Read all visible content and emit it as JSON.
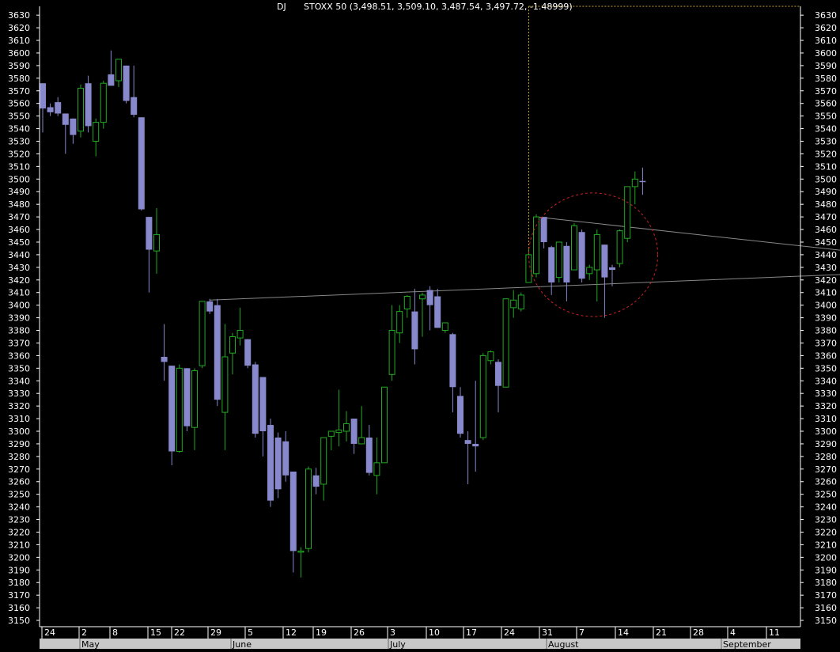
{
  "header": {
    "source": "DJ",
    "quote": "STOXX 50 (3,498.51, 3,509.10, 3,487.54, 3,497.72, -1.48999)"
  },
  "colors": {
    "background": "#000000",
    "axis": "#ffffff",
    "up": "#22aa22",
    "down": "#8888cc",
    "trendline": "#888888",
    "circle": "#cc2222",
    "crosshair": "#ccaa33",
    "bottom_bar": "#c8c8c8"
  },
  "chart_data": {
    "type": "candlestick",
    "title": "STOXX 50",
    "ylim": [
      3145,
      3637
    ],
    "y_ticks": [
      3150,
      3160,
      3170,
      3180,
      3190,
      3200,
      3210,
      3220,
      3230,
      3240,
      3250,
      3260,
      3270,
      3280,
      3290,
      3300,
      3310,
      3320,
      3330,
      3340,
      3350,
      3360,
      3370,
      3380,
      3390,
      3400,
      3410,
      3420,
      3430,
      3440,
      3450,
      3460,
      3470,
      3480,
      3490,
      3500,
      3510,
      3520,
      3530,
      3540,
      3550,
      3560,
      3570,
      3580,
      3590,
      3600,
      3610,
      3620,
      3630
    ],
    "x_day_labels": [
      "24",
      "2",
      "8",
      "15",
      "22",
      "29",
      "5",
      "12",
      "19",
      "26",
      "3",
      "10",
      "17",
      "24",
      "31",
      "7",
      "14",
      "21",
      "28",
      "4",
      "11"
    ],
    "x_month_labels": [
      "May",
      "June",
      "July",
      "August",
      "September"
    ],
    "candles": [
      {
        "o": 3576,
        "h": 3576,
        "l": 3537,
        "c": 3556
      },
      {
        "o": 3557,
        "h": 3560,
        "l": 3550,
        "c": 3553
      },
      {
        "o": 3561,
        "h": 3565,
        "l": 3550,
        "c": 3552
      },
      {
        "o": 3552,
        "h": 3552,
        "l": 3520,
        "c": 3543
      },
      {
        "o": 3548,
        "h": 3548,
        "l": 3528,
        "c": 3535
      },
      {
        "o": 3538,
        "h": 3575,
        "l": 3533,
        "c": 3572
      },
      {
        "o": 3576,
        "h": 3582,
        "l": 3537,
        "c": 3542
      },
      {
        "o": 3530,
        "h": 3548,
        "l": 3518,
        "c": 3545
      },
      {
        "o": 3545,
        "h": 3578,
        "l": 3540,
        "c": 3576
      },
      {
        "o": 3583,
        "h": 3602,
        "l": 3578,
        "c": 3574
      },
      {
        "o": 3578,
        "h": 3595,
        "l": 3573,
        "c": 3595
      },
      {
        "o": 3590,
        "h": 3590,
        "l": 3560,
        "c": 3562
      },
      {
        "o": 3565,
        "h": 3590,
        "l": 3549,
        "c": 3551
      },
      {
        "o": 3549,
        "h": 3549,
        "l": 3475,
        "c": 3476
      },
      {
        "o": 3470,
        "h": 3470,
        "l": 3410,
        "c": 3444
      },
      {
        "o": 3443,
        "h": 3477,
        "l": 3425,
        "c": 3456
      },
      {
        "o": 3359,
        "h": 3385,
        "l": 3340,
        "c": 3355
      },
      {
        "o": 3352,
        "h": 3352,
        "l": 3273,
        "c": 3284
      },
      {
        "o": 3284,
        "h": 3353,
        "l": 3283,
        "c": 3350
      },
      {
        "o": 3350,
        "h": 3350,
        "l": 3300,
        "c": 3304
      },
      {
        "o": 3303,
        "h": 3350,
        "l": 3285,
        "c": 3348
      },
      {
        "o": 3352,
        "h": 3403,
        "l": 3350,
        "c": 3403
      },
      {
        "o": 3403,
        "h": 3405,
        "l": 3393,
        "c": 3395
      },
      {
        "o": 3400,
        "h": 3405,
        "l": 3320,
        "c": 3325
      },
      {
        "o": 3315,
        "h": 3385,
        "l": 3285,
        "c": 3359
      },
      {
        "o": 3362,
        "h": 3378,
        "l": 3345,
        "c": 3375
      },
      {
        "o": 3374,
        "h": 3398,
        "l": 3368,
        "c": 3380
      },
      {
        "o": 3373,
        "h": 3373,
        "l": 3350,
        "c": 3352
      },
      {
        "o": 3353,
        "h": 3355,
        "l": 3295,
        "c": 3298
      },
      {
        "o": 3343,
        "h": 3343,
        "l": 3280,
        "c": 3300
      },
      {
        "o": 3305,
        "h": 3310,
        "l": 3240,
        "c": 3245
      },
      {
        "o": 3295,
        "h": 3299,
        "l": 3247,
        "c": 3254
      },
      {
        "o": 3292,
        "h": 3300,
        "l": 3260,
        "c": 3265
      },
      {
        "o": 3268,
        "h": 3268,
        "l": 3188,
        "c": 3205
      },
      {
        "o": 3205,
        "h": 3208,
        "l": 3184,
        "c": 3205
      },
      {
        "o": 3207,
        "h": 3272,
        "l": 3204,
        "c": 3270
      },
      {
        "o": 3265,
        "h": 3271,
        "l": 3250,
        "c": 3256
      },
      {
        "o": 3258,
        "h": 3295,
        "l": 3245,
        "c": 3295
      },
      {
        "o": 3296,
        "h": 3300,
        "l": 3285,
        "c": 3300
      },
      {
        "o": 3299,
        "h": 3333,
        "l": 3288,
        "c": 3301
      },
      {
        "o": 3300,
        "h": 3316,
        "l": 3292,
        "c": 3306
      },
      {
        "o": 3310,
        "h": 3310,
        "l": 3282,
        "c": 3290
      },
      {
        "o": 3290,
        "h": 3320,
        "l": 3290,
        "c": 3295
      },
      {
        "o": 3295,
        "h": 3305,
        "l": 3265,
        "c": 3267
      },
      {
        "o": 3265,
        "h": 3295,
        "l": 3250,
        "c": 3275
      },
      {
        "o": 3275,
        "h": 3335,
        "l": 3275,
        "c": 3335
      },
      {
        "o": 3345,
        "h": 3400,
        "l": 3340,
        "c": 3380
      },
      {
        "o": 3378,
        "h": 3400,
        "l": 3370,
        "c": 3395
      },
      {
        "o": 3397,
        "h": 3408,
        "l": 3390,
        "c": 3407
      },
      {
        "o": 3395,
        "h": 3413,
        "l": 3353,
        "c": 3365
      },
      {
        "o": 3405,
        "h": 3410,
        "l": 3375,
        "c": 3408
      },
      {
        "o": 3412,
        "h": 3415,
        "l": 3380,
        "c": 3400
      },
      {
        "o": 3407,
        "h": 3413,
        "l": 3382,
        "c": 3382
      },
      {
        "o": 3380,
        "h": 3386,
        "l": 3378,
        "c": 3386
      },
      {
        "o": 3377,
        "h": 3378,
        "l": 3315,
        "c": 3335
      },
      {
        "o": 3328,
        "h": 3335,
        "l": 3295,
        "c": 3298
      },
      {
        "o": 3293,
        "h": 3300,
        "l": 3258,
        "c": 3290
      },
      {
        "o": 3290,
        "h": 3340,
        "l": 3268,
        "c": 3288
      },
      {
        "o": 3295,
        "h": 3362,
        "l": 3293,
        "c": 3360
      },
      {
        "o": 3356,
        "h": 3364,
        "l": 3353,
        "c": 3363
      },
      {
        "o": 3355,
        "h": 3357,
        "l": 3315,
        "c": 3336
      },
      {
        "o": 3335,
        "h": 3405,
        "l": 3335,
        "c": 3405
      },
      {
        "o": 3398,
        "h": 3412,
        "l": 3390,
        "c": 3404
      },
      {
        "o": 3397,
        "h": 3410,
        "l": 3395,
        "c": 3408
      },
      {
        "o": 3418,
        "h": 3445,
        "l": 3418,
        "c": 3440
      },
      {
        "o": 3425,
        "h": 3472,
        "l": 3422,
        "c": 3470
      },
      {
        "o": 3470,
        "h": 3470,
        "l": 3445,
        "c": 3450
      },
      {
        "o": 3446,
        "h": 3447,
        "l": 3408,
        "c": 3418
      },
      {
        "o": 3422,
        "h": 3450,
        "l": 3418,
        "c": 3450
      },
      {
        "o": 3447,
        "h": 3450,
        "l": 3403,
        "c": 3418
      },
      {
        "o": 3428,
        "h": 3465,
        "l": 3428,
        "c": 3463
      },
      {
        "o": 3458,
        "h": 3460,
        "l": 3418,
        "c": 3421
      },
      {
        "o": 3425,
        "h": 3432,
        "l": 3420,
        "c": 3430
      },
      {
        "o": 3428,
        "h": 3460,
        "l": 3403,
        "c": 3456
      },
      {
        "o": 3448,
        "h": 3448,
        "l": 3390,
        "c": 3422
      },
      {
        "o": 3430,
        "h": 3432,
        "l": 3415,
        "c": 3428
      },
      {
        "o": 3433,
        "h": 3460,
        "l": 3430,
        "c": 3459
      },
      {
        "o": 3453,
        "h": 3490,
        "l": 3450,
        "c": 3494
      },
      {
        "o": 3494,
        "h": 3506,
        "l": 3480,
        "c": 3500
      },
      {
        "o": 3498.51,
        "h": 3509.1,
        "l": 3487.54,
        "c": 3497.72
      }
    ],
    "trendlines": [
      {
        "from": [
          22,
          3404
        ],
        "to": [
          112,
          3426
        ]
      },
      {
        "from": [
          65,
          3470
        ],
        "to": [
          112,
          3439
        ]
      }
    ],
    "highlight_circle": {
      "center": [
        72.5,
        3440
      ],
      "radius_x": 8.5,
      "radius_y": 49
    },
    "crosshair": {
      "x": [
        64,
        3420
      ],
      "y": 3637
    }
  }
}
